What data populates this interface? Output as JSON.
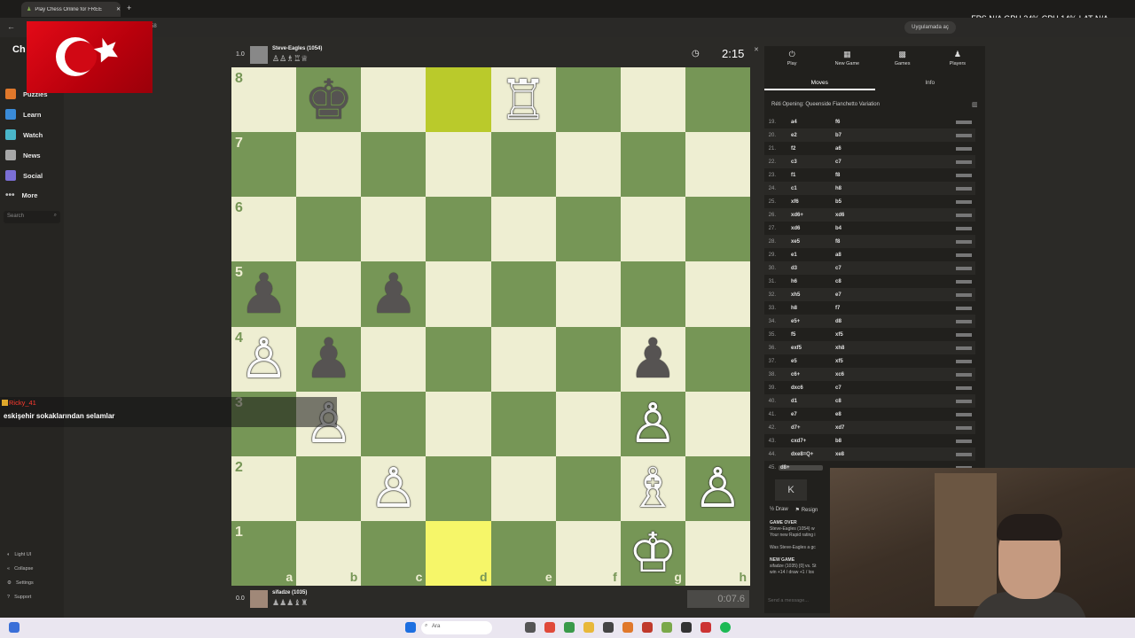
{
  "browser": {
    "tab_title": "Play Chess Online for FREE",
    "url_fragment": "58",
    "ext_badge": "Uygulamada aç",
    "hud": "FPS N/A GPU 24% CPU 14% LAT N/A"
  },
  "sidebar": {
    "logo": "Ch",
    "items": [
      {
        "label": "Puzzles"
      },
      {
        "label": "Learn"
      },
      {
        "label": "Watch"
      },
      {
        "label": "News"
      },
      {
        "label": "Social"
      },
      {
        "label": "More"
      }
    ],
    "search_placeholder": "Search",
    "bottom_links": [
      "Light UI",
      "Collapse",
      "Settings",
      "Support"
    ]
  },
  "top_player": {
    "score": "1.0",
    "name": "Steve-Eagles (1054)",
    "clock": "2:15"
  },
  "bottom_player": {
    "score": "0.0",
    "name": "sifadze (1035)",
    "clock": "0:07.6"
  },
  "board": {
    "ranks": [
      "8",
      "7",
      "6",
      "5",
      "4",
      "3",
      "2",
      "1"
    ],
    "files": [
      "a",
      "b",
      "c",
      "d",
      "e",
      "f",
      "g",
      "h"
    ],
    "pieces": {
      "b8": "♚",
      "e8": "♖",
      "a5": "♟",
      "c5": "♟",
      "a4": "♙",
      "b4": "♟",
      "g4": "♟",
      "b3": "♙",
      "g3": "♙",
      "c2": "♙",
      "g2": "♗",
      "h2": "♙",
      "g1": "♔"
    },
    "highlight": [
      "d8",
      "d1"
    ]
  },
  "panel": {
    "tabs": [
      {
        "icon": "⏻",
        "label": "Play"
      },
      {
        "icon": "▦",
        "label": "New Game"
      },
      {
        "icon": "▩",
        "label": "Games"
      },
      {
        "icon": "♟",
        "label": "Players"
      }
    ],
    "subtabs": [
      "Moves",
      "Info"
    ],
    "opening": "Réti Opening: Queenside Fianchetto Variation",
    "moves": [
      {
        "n": "19.",
        "w": "a4",
        "b": "f6"
      },
      {
        "n": "20.",
        "w": "e2",
        "b": "b7"
      },
      {
        "n": "21.",
        "w": "f2",
        "b": "a6"
      },
      {
        "n": "22.",
        "w": "c3",
        "b": "c7"
      },
      {
        "n": "23.",
        "w": "f1",
        "b": "f8"
      },
      {
        "n": "24.",
        "w": "c1",
        "b": "h8"
      },
      {
        "n": "25.",
        "w": "xf6",
        "b": "b5"
      },
      {
        "n": "26.",
        "w": "xd6+",
        "b": "xd6"
      },
      {
        "n": "27.",
        "w": "xd6",
        "b": "b4"
      },
      {
        "n": "28.",
        "w": "xe5",
        "b": "f8"
      },
      {
        "n": "29.",
        "w": "e1",
        "b": "a8"
      },
      {
        "n": "30.",
        "w": "d3",
        "b": "c7"
      },
      {
        "n": "31.",
        "w": "h6",
        "b": "c8"
      },
      {
        "n": "32.",
        "w": "xh5",
        "b": "e7"
      },
      {
        "n": "33.",
        "w": "h8",
        "b": "f7"
      },
      {
        "n": "34.",
        "w": "e5+",
        "b": "d8"
      },
      {
        "n": "35.",
        "w": "f5",
        "b": "xf5"
      },
      {
        "n": "36.",
        "w": "exf5",
        "b": "xh8"
      },
      {
        "n": "37.",
        "w": "e5",
        "b": "xf5"
      },
      {
        "n": "38.",
        "w": "c6+",
        "b": "xc6"
      },
      {
        "n": "39.",
        "w": "dxc6",
        "b": "c7"
      },
      {
        "n": "40.",
        "w": "d1",
        "b": "c8"
      },
      {
        "n": "41.",
        "w": "e7",
        "b": "e8"
      },
      {
        "n": "42.",
        "w": "d7+",
        "b": "xd7"
      },
      {
        "n": "43.",
        "w": "cxd7+",
        "b": "b8"
      },
      {
        "n": "44.",
        "w": "dxe8=Q+",
        "b": "xe8"
      },
      {
        "n": "45.",
        "w": "d8+",
        "b": ""
      }
    ],
    "nav_first": "K",
    "draw": "½ Draw",
    "resign": "⚑ Resign",
    "chat": {
      "game_over": "GAME OVER",
      "line1": "Steve-Eagles (1054) w",
      "line2": "Your new Rapid rating i",
      "line3": "Was Steve-Eagles a gc",
      "new_game": "NEW GAME",
      "line4": "sifadze (1035) [0] vs. St",
      "line5": "win +14 / draw +1 / los"
    },
    "send_placeholder": "Send a message..."
  },
  "stream_chat": {
    "user": "Ricky_41",
    "message": "eskişehir sokaklarından selamlar"
  },
  "taskbar": {
    "search": "Ara"
  }
}
